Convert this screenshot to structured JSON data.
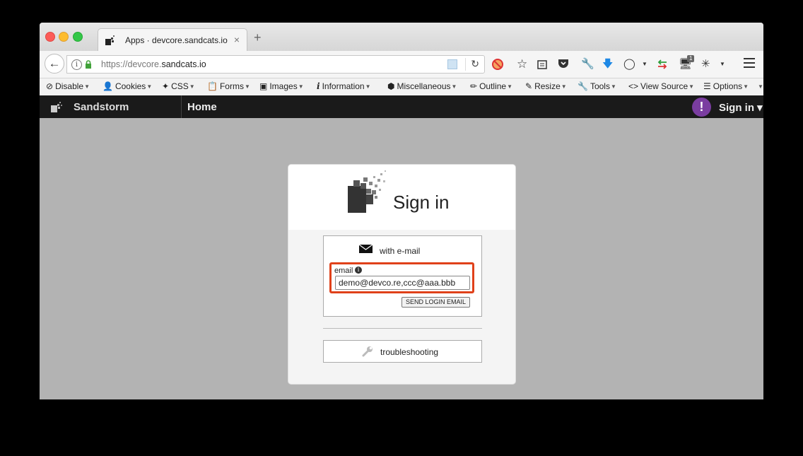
{
  "browser": {
    "tab_title": "Apps · devcore.sandcats.io",
    "tab_close": "×",
    "new_tab": "+",
    "url_prefix": "https://devcore.",
    "url_domain": "sandcats.io",
    "tb_badge": "1"
  },
  "devtoolbar": {
    "items": [
      "Disable",
      "Cookies",
      "CSS",
      "Forms",
      "Images",
      "Information",
      "Miscellaneous",
      "Outline",
      "Resize",
      "Tools",
      "View Source",
      "Options"
    ]
  },
  "appbar": {
    "brand": "Sandstorm",
    "home": "Home",
    "alert": "!",
    "signin": "Sign in ▾"
  },
  "signin": {
    "heading": "Sign in",
    "with_email": "with e-mail",
    "email_label": "email",
    "email_value": "demo@devco.re,ccc@aaa.bbb",
    "send_button": "SEND LOGIN EMAIL",
    "troubleshooting": "troubleshooting"
  },
  "colors": {
    "highlight": "#e0411a",
    "appbar": "#1a1a1a",
    "alert": "#7a3da0",
    "background": "#b3b3b3"
  }
}
